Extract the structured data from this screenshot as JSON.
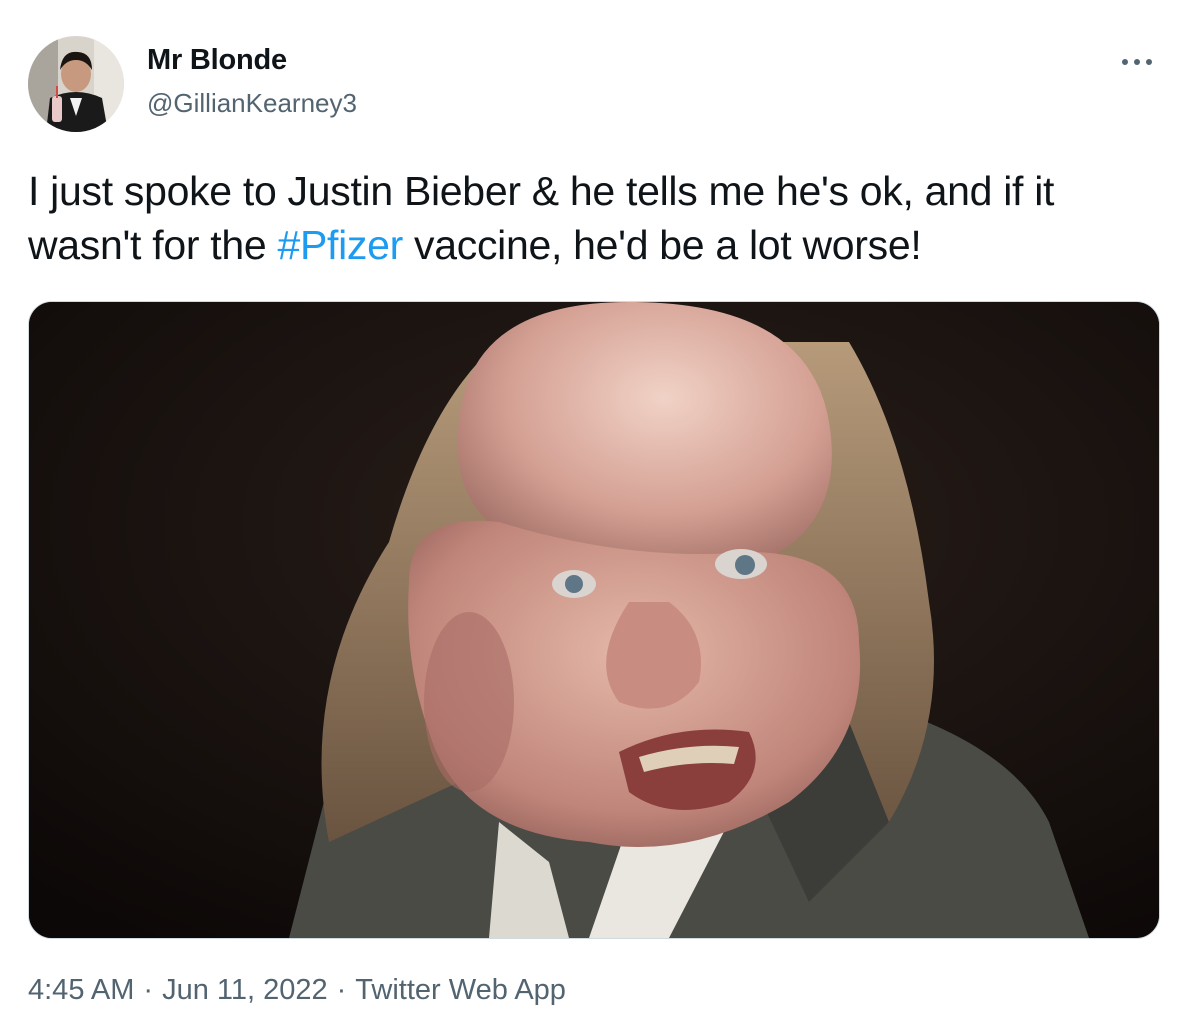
{
  "author": {
    "display_name": "Mr Blonde",
    "handle": "@GillianKearney3",
    "avatar_icon": "profile-photo"
  },
  "more_icon": "more-horizontal-icon",
  "tweet": {
    "text_part1": "I just spoke to Justin Bieber & he tells me he's ok, and if it wasn't for the ",
    "hashtag": "#Pfizer",
    "text_part2": " vaccine, he'd be a lot worse!"
  },
  "media": {
    "type": "photo"
  },
  "meta": {
    "time": "4:45 AM",
    "separator": "·",
    "date": "Jun 11, 2022",
    "source": "Twitter Web App"
  },
  "colors": {
    "link": "#1d9bf0",
    "secondary_text": "#536471",
    "primary_text": "#0f1419",
    "border": "#cfd9de"
  }
}
